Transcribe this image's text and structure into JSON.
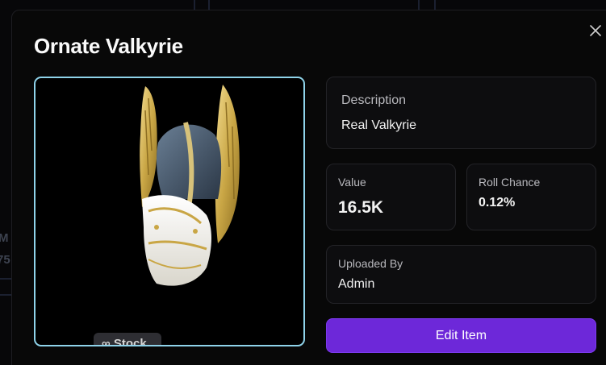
{
  "background": {
    "partial_text_1": "M",
    "partial_text_2": "75"
  },
  "modal": {
    "title": "Ornate Valkyrie",
    "close_icon": "close-icon",
    "image": {
      "alt": "Ornate Valkyrie helmet",
      "stock_badge": "∞ Stock"
    },
    "description": {
      "label": "Description",
      "value": "Real Valkyrie"
    },
    "value": {
      "label": "Value",
      "value": "16.5K"
    },
    "roll_chance": {
      "label": "Roll Chance",
      "value": "0.12%"
    },
    "uploaded_by": {
      "label": "Uploaded By",
      "value": "Admin"
    },
    "edit_button": "Edit Item"
  },
  "colors": {
    "accent": "#6d28d9",
    "image_border": "#8fd3ea",
    "card_bg": "#0d0d0f"
  }
}
